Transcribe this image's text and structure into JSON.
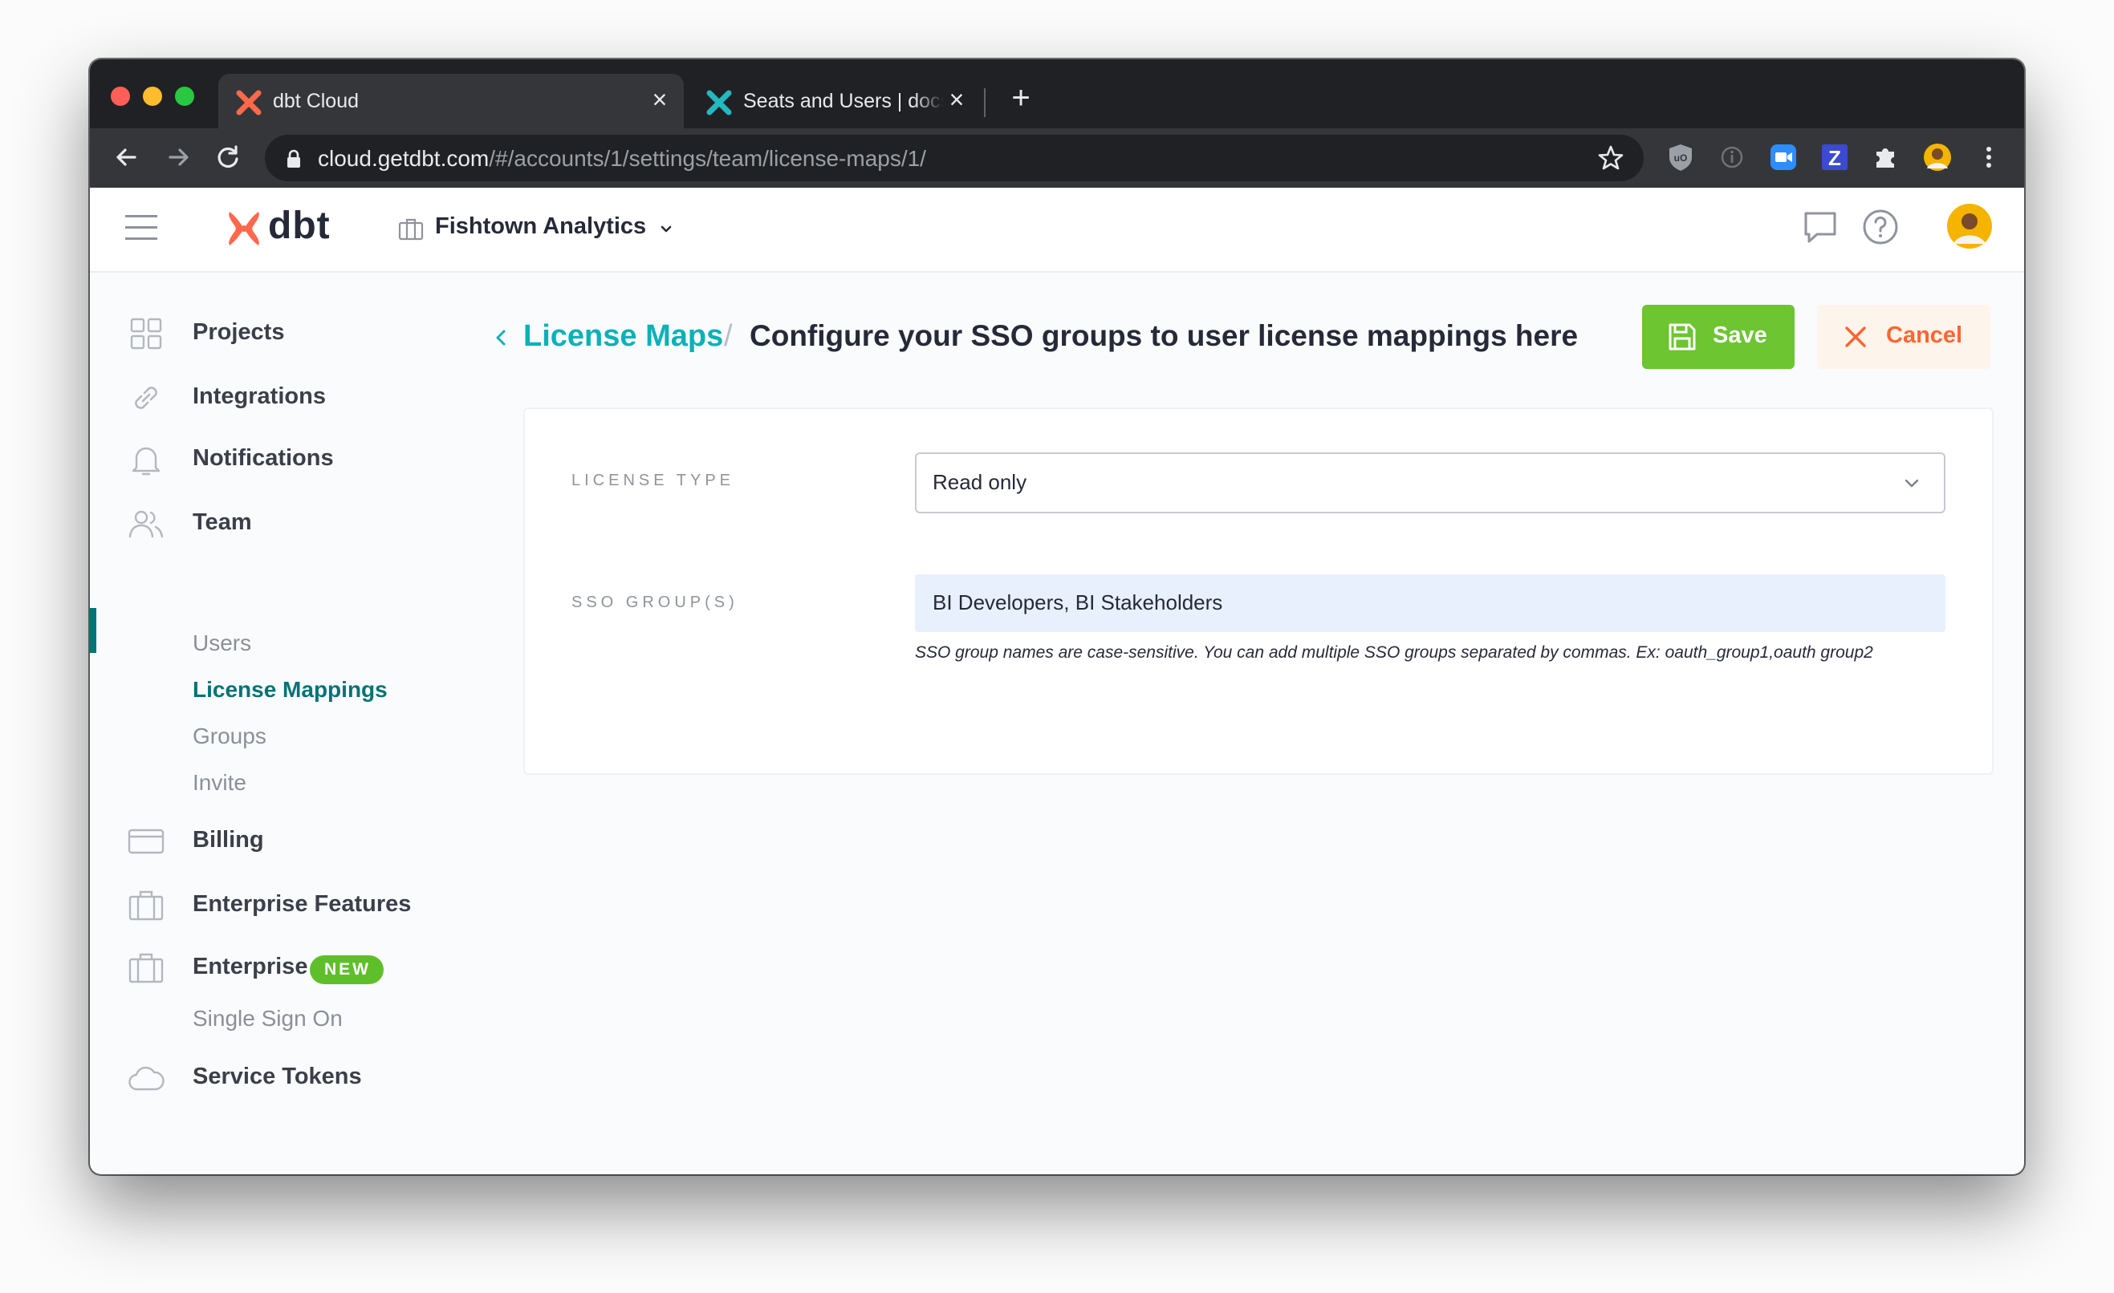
{
  "browser": {
    "tabs": [
      {
        "title": "dbt Cloud",
        "active": true
      },
      {
        "title": "Seats and Users | docs.getdbt.com",
        "active": false
      }
    ],
    "url_host": "cloud.getdbt.com",
    "url_path": "/#/accounts/1/settings/team/license-maps/1/"
  },
  "header": {
    "brand": "dbt",
    "org_name": "Fishtown Analytics"
  },
  "sidebar": {
    "projects": "Projects",
    "integrations": "Integrations",
    "notifications": "Notifications",
    "team": "Team",
    "team_sub": [
      "Users",
      "License Mappings",
      "Groups",
      "Invite"
    ],
    "billing": "Billing",
    "enterprise_features": "Enterprise Features",
    "enterprise": "Enterprise",
    "enterprise_badge": "NEW",
    "enterprise_sub": [
      "Single Sign On"
    ],
    "service_tokens": "Service Tokens"
  },
  "main": {
    "breadcrumb_link": "License Maps",
    "breadcrumb_sep": "/",
    "title": "Configure your SSO groups to user license mappings here",
    "save_label": "Save",
    "cancel_label": "Cancel",
    "form": {
      "license_type_label": "LICENSE TYPE",
      "license_type_value": "Read only",
      "sso_groups_label": "SSO GROUP(S)",
      "sso_groups_value": "BI Developers, BI Stakeholders",
      "sso_groups_help": "SSO group names are case-sensitive. You can add multiple SSO groups separated by commas. Ex: oauth_group1,oauth group2"
    }
  },
  "colors": {
    "brand_orange": "#ff694b",
    "teal_link": "#0bb1b8",
    "active_nav": "#047377",
    "save_green": "#6cc531",
    "cancel_orange": "#ff6531",
    "new_badge": "#5fbf2b"
  },
  "icons": [
    "menu-icon",
    "dbt-logo-icon",
    "briefcase-icon",
    "chat-icon",
    "help-icon",
    "avatar",
    "grid-icon",
    "link-icon",
    "bell-icon",
    "users-icon",
    "credit-card-icon",
    "cloud-icon",
    "save-icon",
    "close-icon",
    "chevron-down-icon",
    "chevron-left-icon"
  ]
}
